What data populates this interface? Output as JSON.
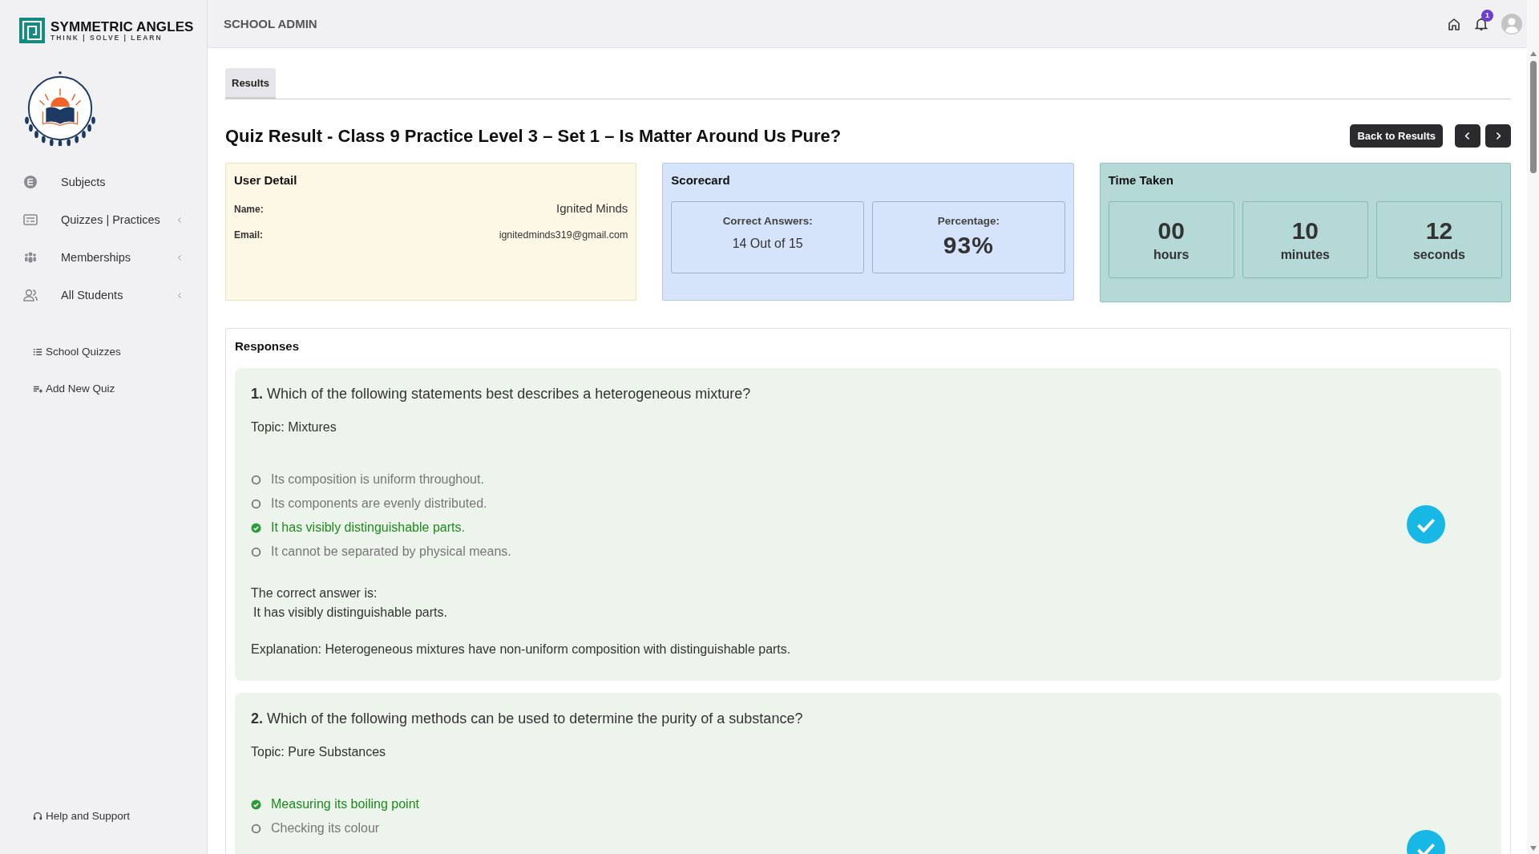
{
  "brand": {
    "name": "SYMMETRIC ANGLES",
    "tagline": "THINK | SOLVE | LEARN"
  },
  "sidebar": {
    "items": [
      {
        "label": "Subjects",
        "kind": "subjects",
        "expandable": false
      },
      {
        "label": "Quizzes | Practices",
        "kind": "quizzes",
        "expandable": true
      },
      {
        "label": "Memberships",
        "kind": "members",
        "expandable": true
      },
      {
        "label": "All Students",
        "kind": "students",
        "expandable": true
      }
    ],
    "links": [
      {
        "label": "School Quizzes",
        "kind": "list"
      },
      {
        "label": "Add New Quiz",
        "kind": "add"
      }
    ],
    "help": {
      "label": "Help and Support"
    }
  },
  "topbar": {
    "title": "SCHOOL ADMIN",
    "notifications": "1"
  },
  "tabs": [
    {
      "label": "Results",
      "selected": true
    }
  ],
  "page_title": "Quiz Result - Class 9 Practice Level 3 – Set 1 – Is Matter Around Us Pure?",
  "back_button": "Back to Results",
  "user_detail": {
    "title": "User Detail",
    "fields": [
      {
        "label": "Name:",
        "value": "Ignited Minds",
        "kind": "name"
      },
      {
        "label": "Email:",
        "value": "ignitedminds319@gmail.com",
        "kind": "email"
      }
    ]
  },
  "scorecard": {
    "title": "Scorecard",
    "stats": [
      {
        "label": "Correct Answers:",
        "value": "14 Out of 15",
        "kind": "text"
      },
      {
        "label": "Percentage:",
        "value": "93%",
        "kind": "big"
      }
    ]
  },
  "time_taken": {
    "title": "Time Taken",
    "units": [
      {
        "value": "00",
        "unit": "hours"
      },
      {
        "value": "10",
        "unit": "minutes"
      },
      {
        "value": "12",
        "unit": "seconds"
      }
    ]
  },
  "responses": {
    "title": "Responses",
    "questions": [
      {
        "text": "**1.** Which of the following statements best describes a heterogeneous mixture?",
        "topic": "Topic: Mixtures",
        "correct": true,
        "options": [
          {
            "text": "Its composition is uniform throughout.",
            "correct": false
          },
          {
            "text": "Its components are evenly distributed.",
            "correct": false
          },
          {
            "text": "It has visibly distinguishable parts.",
            "correct": true
          },
          {
            "text": "It cannot be separated by physical means.",
            "correct": false
          }
        ],
        "answer_label": "The correct answer is:",
        "answer": "It has visibly distinguishable parts.",
        "explanation": "Explanation: Heterogeneous mixtures have non-uniform composition with distinguishable parts."
      },
      {
        "text": "**2.** Which of the following methods can be used to determine the purity of a substance?",
        "topic": "Topic: Pure Substances",
        "correct": true,
        "options": [
          {
            "text": "Measuring its boiling point",
            "correct": true
          },
          {
            "text": "Checking its colour",
            "correct": false
          }
        ]
      }
    ]
  }
}
